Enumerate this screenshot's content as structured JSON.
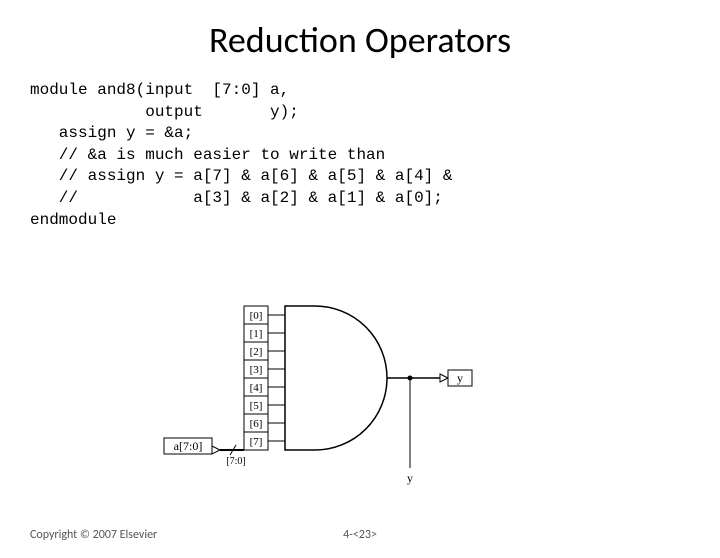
{
  "title": "Reduction Operators",
  "code": {
    "l1": "module and8(input  [7:0] a,",
    "l2": "            output       y);",
    "l3": "   assign y = &a;",
    "l4": "   // &a is much easier to write than",
    "l5": "   // assign y = a[7] & a[6] & a[5] & a[4] &",
    "l6": "   //            a[3] & a[2] & a[1] & a[0];",
    "l7": "endmodule"
  },
  "diagram": {
    "bits": [
      "[0]",
      "[1]",
      "[2]",
      "[3]",
      "[4]",
      "[5]",
      "[6]",
      "[7]"
    ],
    "bus_label": "a[7:0]",
    "bus_range": "[7:0]",
    "output": "y",
    "wire_label": "y"
  },
  "footer": {
    "copyright": "Copyright © 2007 Elsevier",
    "page": "4-<23>"
  }
}
